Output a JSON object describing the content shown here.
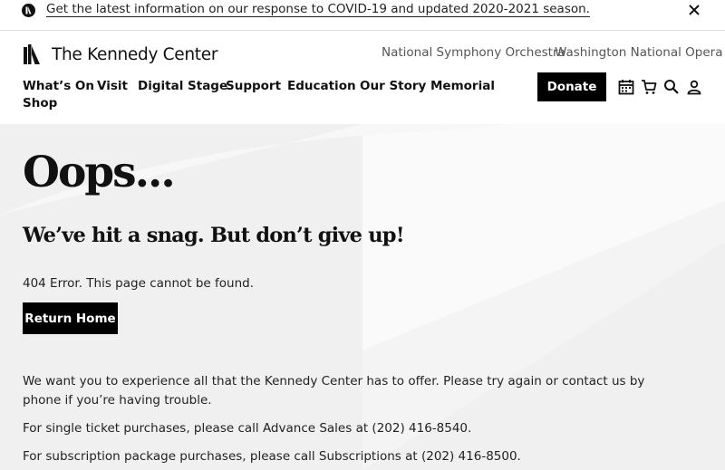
{
  "alert": {
    "text": "Get the latest information on our response to COVID-19 and updated 2020-2021 season.",
    "icon": "info-logo-icon",
    "close_icon": "close-icon"
  },
  "header": {
    "logo_text": "The Kennedy Center",
    "affiliates": [
      "National Symphony Orchestra",
      "Washington National Opera"
    ],
    "nav": [
      "What’s On",
      "Visit",
      "Digital Stage",
      "Support",
      "Education",
      "Our Story",
      "Memorial",
      "Shop"
    ],
    "donate_label": "Donate",
    "icons": [
      "calendar-icon",
      "cart-icon",
      "search-icon",
      "user-icon"
    ]
  },
  "main": {
    "heading": "Oops...",
    "subheading": "We’ve hit a snag. But don’t give up!",
    "error_text": "404 Error. This page cannot be found.",
    "return_label": "Return Home",
    "paragraphs": [
      "We want you to experience all that the Kennedy Center has to offer. Please try again or contact us by phone if you’re having trouble.",
      "For single ticket purchases, please call Advance Sales at (202) 416-8540.",
      "For subscription package purchases, please call Subscriptions at (202) 416-8500."
    ]
  },
  "colors": {
    "accent": "#000000",
    "content_bg": "#f0f0f0",
    "content_shape": "#fafafa"
  }
}
